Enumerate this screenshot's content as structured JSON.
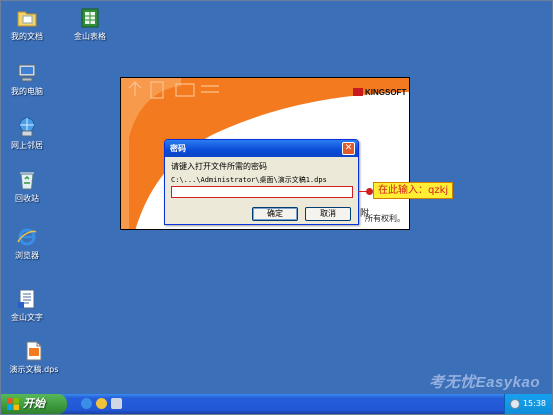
{
  "desktop_icons": [
    {
      "name": "my-documents",
      "label": "我的文档",
      "icon": "folder-documents-icon"
    },
    {
      "name": "kingsoft-spreadsheet",
      "label": "金山表格",
      "icon": "spreadsheet-icon"
    },
    {
      "name": "my-computer",
      "label": "我的电脑",
      "icon": "computer-icon"
    },
    {
      "name": "network-places",
      "label": "网上邻居",
      "icon": "network-icon"
    },
    {
      "name": "recycle-bin",
      "label": "回收站",
      "icon": "recycle-bin-icon"
    },
    {
      "name": "browser",
      "label": "浏览器",
      "icon": "ie-icon"
    },
    {
      "name": "kingsoft-writer",
      "label": "金山文字",
      "icon": "writer-icon"
    },
    {
      "name": "presentation-file",
      "label": "演示文稿.dps",
      "icon": "presentation-file-icon"
    }
  ],
  "splash": {
    "logo": "KINGSOFT",
    "copyright_fragment": "所有权利。",
    "side_char": "附"
  },
  "dialog": {
    "title": "密码",
    "prompt": "请键入打开文件所需的密码",
    "path": "C:\\...\\Administrator\\桌面\\演示文稿1.dps",
    "password_value": "",
    "ok_label": "确定",
    "cancel_label": "取消",
    "close_glyph": "✕"
  },
  "hint": {
    "text": "在此输入：qzkj"
  },
  "watermark": "考无忧Easykao",
  "taskbar": {
    "start_label": "开始",
    "clock": "15:38"
  },
  "colors": {
    "desktop": "#3b6fb8",
    "accent_orange": "#f47a1f",
    "hint_red": "#d02020",
    "hint_bg": "#ffee33"
  }
}
